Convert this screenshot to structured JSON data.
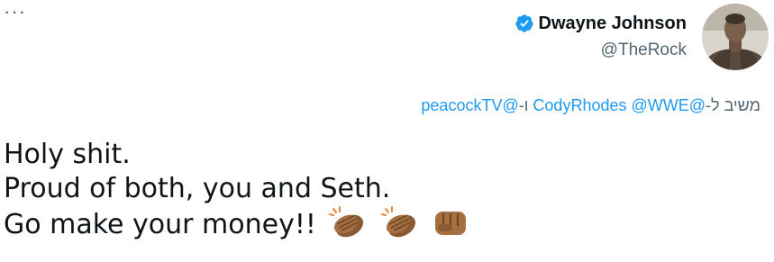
{
  "tweet": {
    "more_label": "···",
    "author": {
      "display_name": "Dwayne Johnson",
      "handle": "@TheRock",
      "verified": true
    },
    "reply_context": {
      "prefix": "משיב ל-",
      "mention_1": "@CodyRhodes",
      "mention_2": "@WWE",
      "conjunction": "ו-",
      "mention_3": "@peacockTV"
    },
    "text_lines": [
      "Holy shit.",
      "Proud of both, you and Seth.",
      "Go make your money!!"
    ],
    "emojis": [
      "clapping-hands-icon",
      "clapping-hands-icon",
      "fist-bump-icon"
    ]
  },
  "colors": {
    "text_primary": "#0f1419",
    "text_secondary": "#536471",
    "link": "#1d9bf0",
    "verified_badge": "#1d9bf0"
  }
}
